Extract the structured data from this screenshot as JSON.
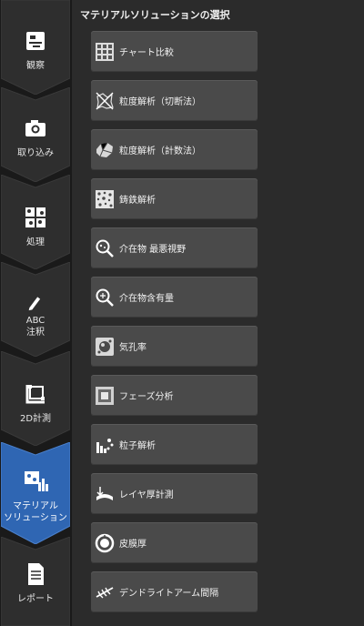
{
  "sidebar": {
    "steps": [
      {
        "label": "観察",
        "icon": "microscope-icon"
      },
      {
        "label": "取り込み",
        "icon": "camera-icon"
      },
      {
        "label": "処理",
        "icon": "process-grid-icon"
      },
      {
        "label": "ABC\n注釈",
        "icon": "pen-annotation-icon"
      },
      {
        "label": "2D計測",
        "icon": "measure-2d-icon"
      },
      {
        "label": "マテリアル\nソリューション",
        "icon": "material-solution-icon",
        "active": true
      },
      {
        "label": "レポート",
        "icon": "report-document-icon"
      }
    ],
    "active_color": "#2f66b3"
  },
  "panel": {
    "title": "マテリアルソリューションの選択",
    "buttons": [
      {
        "label": "チャート比較",
        "icon": "chart-compare-icon"
      },
      {
        "label": "粒度解析（切断法）",
        "icon": "grain-intercept-icon"
      },
      {
        "label": "粒度解析（計数法）",
        "icon": "grain-count-icon"
      },
      {
        "label": "鋳鉄解析",
        "icon": "cast-iron-icon"
      },
      {
        "label": "介在物 最悪視野",
        "icon": "inclusion-worst-field-icon"
      },
      {
        "label": "介在物含有量",
        "icon": "inclusion-content-icon"
      },
      {
        "label": "気孔率",
        "icon": "porosity-icon"
      },
      {
        "label": "フェーズ分析",
        "icon": "phase-analysis-icon"
      },
      {
        "label": "粒子解析",
        "icon": "particle-analysis-icon"
      },
      {
        "label": "レイヤ厚計測",
        "icon": "layer-thickness-icon"
      },
      {
        "label": "皮膜厚",
        "icon": "coating-thickness-icon"
      },
      {
        "label": "デンドライトアーム間隔",
        "icon": "dendrite-arm-spacing-icon"
      }
    ]
  }
}
